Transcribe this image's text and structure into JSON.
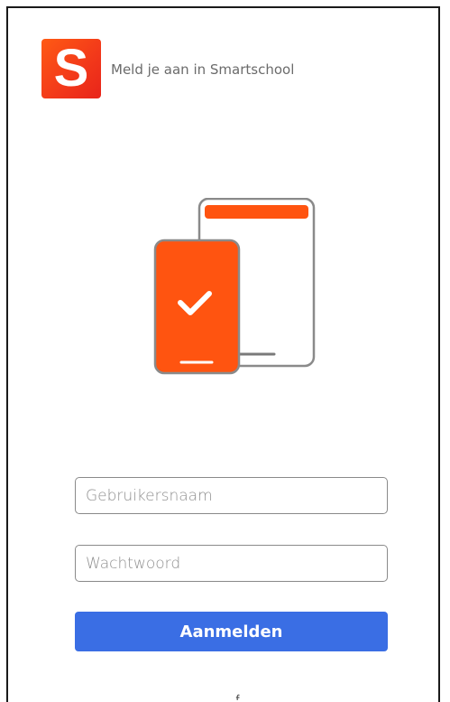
{
  "header": {
    "logo_letter": "S",
    "title": "Meld je aan in Smartschool"
  },
  "illustration": {
    "icon": "devices-checkmark-icon",
    "colors": {
      "accent": "#ff5410",
      "outline": "#8a8a8a",
      "check": "#ffffff"
    }
  },
  "form": {
    "username_placeholder": "Gebruikersnaam",
    "password_placeholder": "Wachtwoord",
    "submit_label": "Aanmelden"
  },
  "colors": {
    "brand": "#f2381a",
    "primary_button": "#3a6ee4"
  }
}
